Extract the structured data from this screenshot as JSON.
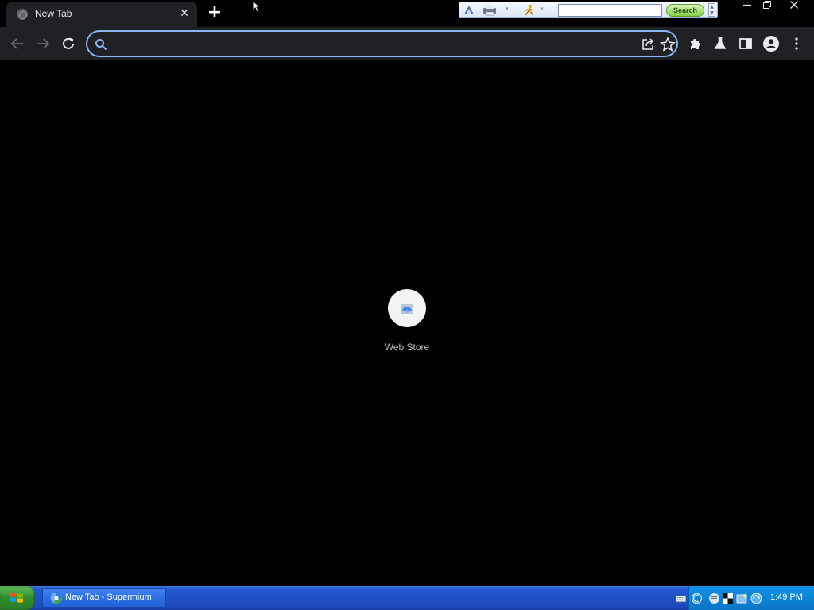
{
  "tabs": [
    {
      "title": "New Tab",
      "close_icon": "close-icon"
    }
  ],
  "new_tab_icon": "plus-icon",
  "legacy_toolbar": {
    "search_value": "",
    "search_label": "Search"
  },
  "window_controls": [
    "minimize-icon",
    "restore-icon",
    "close-icon"
  ],
  "toolbar": {
    "omnibox_value": "",
    "omnibox_placeholder": ""
  },
  "shortcuts": [
    {
      "label": "Web Store"
    }
  ],
  "taskbar": {
    "task_label": "New Tab - Supermium",
    "clock": "1:49 PM"
  },
  "colors": {
    "accent": "#8ab4f8",
    "toolbar_bg": "#202124",
    "taskbar_blue": "#1f52c8"
  }
}
